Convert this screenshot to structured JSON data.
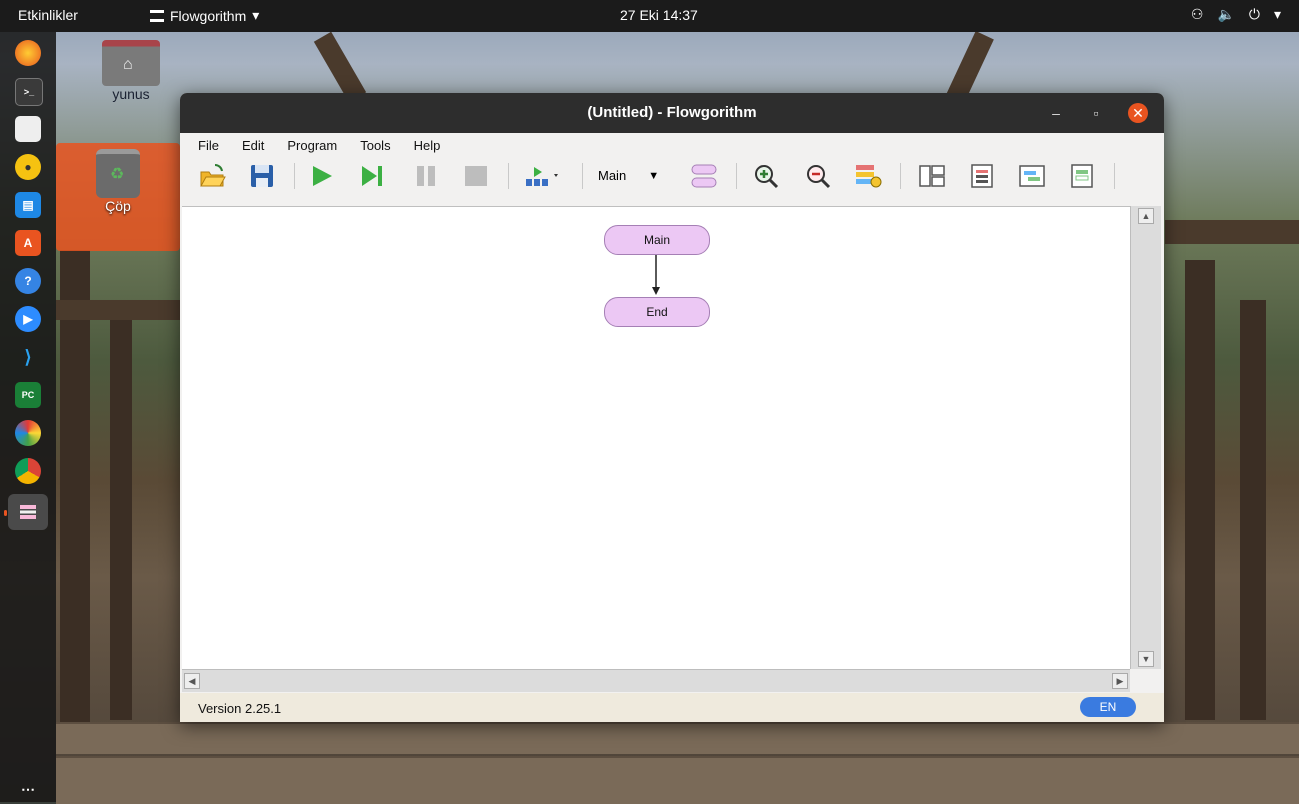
{
  "topbar": {
    "activities": "Etkinlikler",
    "app_name": "Flowgorithm",
    "clock": "27 Eki  14:37"
  },
  "desktop": {
    "home_label": "yunus",
    "trash_label": "Çöp"
  },
  "dock": {
    "icons": [
      "firefox-icon",
      "terminal-icon",
      "files-icon",
      "rhythmbox-icon",
      "libreoffice-writer-icon",
      "software-center-icon",
      "help-icon",
      "zoom-icon",
      "vscode-icon",
      "pycharm-icon",
      "pinwheel-icon",
      "chrome-icon",
      "flowgorithm-icon"
    ],
    "show_apps_label": "⋯"
  },
  "window": {
    "title": "(Untitled) - Flowgorithm",
    "menu": [
      "File",
      "Edit",
      "Program",
      "Tools",
      "Help"
    ],
    "toolbar": {
      "function_select": "Main",
      "icons": [
        "open-icon",
        "save-icon",
        "run-icon",
        "step-icon",
        "pause-icon",
        "stop-icon",
        "speed-icon",
        "function-select",
        "function-shape-icon",
        "zoom-in-icon",
        "zoom-out-icon",
        "variables-icon",
        "layout-1-icon",
        "layout-2-icon",
        "layout-3-icon",
        "layout-4-icon"
      ]
    },
    "flowchart": {
      "nodes": [
        "Main",
        "End"
      ]
    },
    "status": {
      "version": "Version 2.25.1",
      "language": "EN"
    }
  },
  "colors": {
    "node_fill": "#ecc8f4",
    "titlebar": "#2d2d2d",
    "close_button": "#e95420",
    "language_badge": "#3a7be0"
  }
}
